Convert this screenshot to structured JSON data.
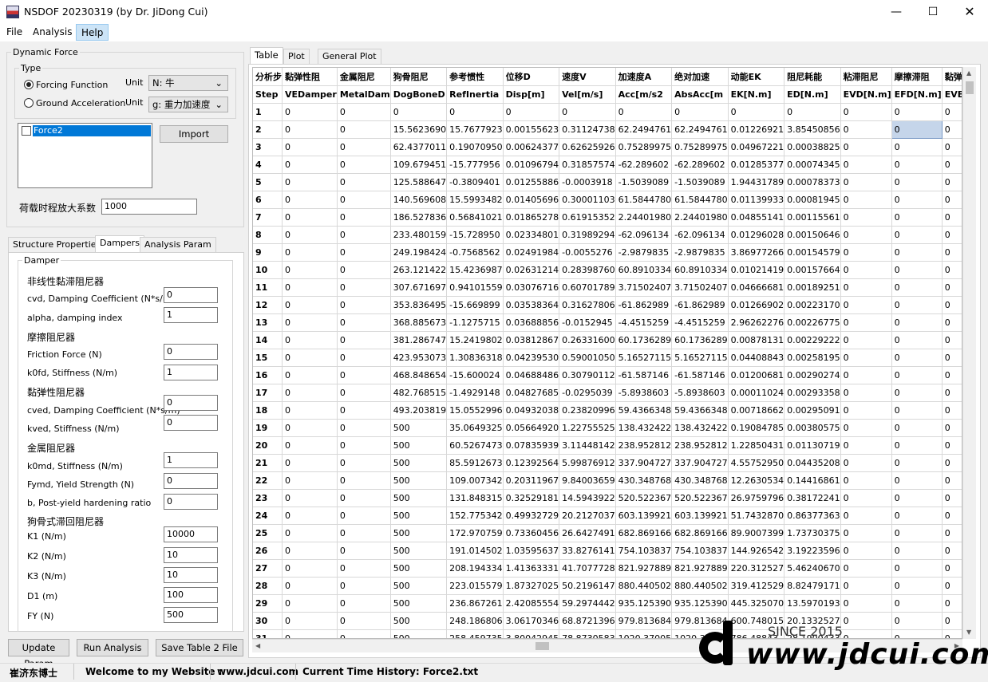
{
  "window": {
    "title": "NSDOF 20230319 (by Dr. JiDong Cui)"
  },
  "menu": [
    "File",
    "Analysis",
    "Help"
  ],
  "dynamic_force": {
    "group_label": "Dynamic Force",
    "type_label": "Type",
    "forcing_function": "Forcing Function",
    "ground_acceleration": "Ground Acceleration",
    "unit_label": "Unit",
    "unit_force": "N: 牛",
    "unit_accel": "g: 重力加速度",
    "list_items": [
      "Force2"
    ],
    "import_label": "Import",
    "scale_label": "荷载时程放大系数",
    "scale_value": "1000"
  },
  "left_tabs": [
    "Structure Properties",
    "Dampers",
    "Analysis Param"
  ],
  "damper": {
    "group_label": "Damper",
    "nonlinear_title": "非线性黏滞阻尼器",
    "cvd_label": "cvd, Damping Coefficient (N*s/m)",
    "cvd_value": "0",
    "alpha_label": "alpha, damping index",
    "alpha_value": "1",
    "friction_title": "摩擦阻尼器",
    "friction_label": "Friction Force (N)",
    "friction_value": "0",
    "k0fd_label": "k0fd, Stiffness (N/m)",
    "k0fd_value": "1",
    "viscoelastic_title": "黏弹性阻尼器",
    "cved_label": "cved, Damping Coefficient (N*s/m)",
    "cved_value": "0",
    "kved_label": "kved, Stiffness (N/m)",
    "kved_value": "0",
    "metal_title": "金属阻尼器",
    "k0md_label": "k0md, Stiffness (N/m)",
    "k0md_value": "1",
    "fymd_label": "Fymd, Yield Strength (N)",
    "fymd_value": "0",
    "b_label": "b, Post-yield hardening ratio",
    "b_value": "0",
    "dogbone_title": "狗骨式滞回阻尼器",
    "k1_label": "K1  (N/m)",
    "k1_value": "10000",
    "k2_label": "K2  (N/m)",
    "k2_value": "10",
    "k3_label": "K3  (N/m)",
    "k3_value": "10",
    "d1_label": "D1  (m)",
    "d1_value": "100",
    "fy_label": "FY  (N)",
    "fy_value": "500"
  },
  "buttons": {
    "update": "Update Param",
    "run": "Run Analysis",
    "save": "Save Table 2 File"
  },
  "right_tabs": [
    "Table",
    "Plot",
    "General Plot"
  ],
  "table": {
    "header_cn": [
      "分析步",
      "黏弹性阻",
      "金属阻尼",
      "狗骨阻尼",
      "参考惯性",
      "位移D",
      "速度V",
      "加速度A",
      "绝对加速",
      "动能EK",
      "阻尼耗能",
      "粘滞阻尼",
      "摩擦滞阻",
      "黏弹性阻"
    ],
    "header_en": [
      "Step",
      "VEDamper",
      "MetalDam",
      "DogBoneD",
      "RefInertia",
      "Disp[m]",
      "Vel[m/s]",
      "Acc[m/s2",
      "AbsAcc[m",
      "EK[N.m]",
      "ED[N.m]",
      "EVD[N.m]",
      "EFD[N.m]",
      "EVED[N.m"
    ],
    "rows": [
      [
        "1",
        "0",
        "0",
        "0",
        "0",
        "0",
        "0",
        "0",
        "0",
        "0",
        "0",
        "0",
        "0",
        "0"
      ],
      [
        "2",
        "0",
        "0",
        "15.5623690",
        "15.7677923",
        "0.00155623",
        "0.31124738",
        "62.2494761",
        "62.2494761",
        "0.01226921",
        "3.85450856",
        "0",
        "0",
        "0"
      ],
      [
        "3",
        "0",
        "0",
        "62.4377011",
        "0.19070950",
        "0.00624377",
        "0.62625926",
        "0.75289975",
        "0.75289975",
        "0.04967221",
        "0.00038825",
        "0",
        "0",
        "0"
      ],
      [
        "4",
        "0",
        "0",
        "109.679451",
        "-15.777956",
        "0.01096794",
        "0.31857574",
        "-62.289602",
        "-62.289602",
        "0.01285377",
        "0.00074345",
        "0",
        "0",
        "0"
      ],
      [
        "5",
        "0",
        "0",
        "125.588647",
        "-0.3809401",
        "0.01255886",
        "-0.0003918",
        "-1.5039089",
        "-1.5039089",
        "1.94431789",
        "0.00078373",
        "0",
        "0",
        "0"
      ],
      [
        "6",
        "0",
        "0",
        "140.569608",
        "15.5993482",
        "0.01405696",
        "0.30001103",
        "61.5844780",
        "61.5844780",
        "0.01139933",
        "0.00081945",
        "0",
        "0",
        "0"
      ],
      [
        "7",
        "0",
        "0",
        "186.527836",
        "0.56841021",
        "0.01865278",
        "0.61915352",
        "2.24401980",
        "2.24401980",
        "0.04855141",
        "0.00115561",
        "0",
        "0",
        "0"
      ],
      [
        "8",
        "0",
        "0",
        "233.480159",
        "-15.728950",
        "0.02334801",
        "0.31989294",
        "-62.096134",
        "-62.096134",
        "0.01296028",
        "0.00150646",
        "0",
        "0",
        "0"
      ],
      [
        "9",
        "0",
        "0",
        "249.198424",
        "-0.7568562",
        "0.02491984",
        "-0.0055276",
        "-2.9879835",
        "-2.9879835",
        "3.86977266",
        "0.00154579",
        "0",
        "0",
        "0"
      ],
      [
        "10",
        "0",
        "0",
        "263.121422",
        "15.4236987",
        "0.02631214",
        "0.28398760",
        "60.8910334",
        "60.8910334",
        "0.01021419",
        "0.00157664",
        "0",
        "0",
        "0"
      ],
      [
        "11",
        "0",
        "0",
        "307.671697",
        "0.94101559",
        "0.03076716",
        "0.60701789",
        "3.71502407",
        "3.71502407",
        "0.04666681",
        "0.00189251",
        "0",
        "0",
        "0"
      ],
      [
        "12",
        "0",
        "0",
        "353.836495",
        "-15.669899",
        "0.03538364",
        "0.31627806",
        "-61.862989",
        "-61.862989",
        "0.01266902",
        "0.00223170",
        "0",
        "0",
        "0"
      ],
      [
        "13",
        "0",
        "0",
        "368.885673",
        "-1.1275715",
        "0.03688856",
        "-0.0152945",
        "-4.4515259",
        "-4.4515259",
        "2.96262276",
        "0.00226775",
        "0",
        "0",
        "0"
      ],
      [
        "14",
        "0",
        "0",
        "381.286747",
        "15.2419802",
        "0.03812867",
        "0.26331600",
        "60.1736289",
        "60.1736289",
        "0.00878131",
        "0.00229222",
        "0",
        "0",
        "0"
      ],
      [
        "15",
        "0",
        "0",
        "423.953073",
        "1.30836318",
        "0.04239530",
        "0.59001050",
        "5.16527115",
        "5.16527115",
        "0.04408843",
        "0.00258195",
        "0",
        "0",
        "0"
      ],
      [
        "16",
        "0",
        "0",
        "468.848654",
        "-15.600024",
        "0.04688486",
        "0.30790112",
        "-61.587146",
        "-61.587146",
        "0.01200681",
        "0.00290274",
        "0",
        "0",
        "0"
      ],
      [
        "17",
        "0",
        "0",
        "482.768515",
        "-1.4929148",
        "0.04827685",
        "-0.0295039",
        "-5.8938603",
        "-5.8938603",
        "0.00011024",
        "0.00293358",
        "0",
        "0",
        "0"
      ],
      [
        "18",
        "0",
        "0",
        "493.203819",
        "15.0552996",
        "0.04932038",
        "0.23820996",
        "59.4366348",
        "59.4366348",
        "0.00718662",
        "0.00295091",
        "0",
        "0",
        "0"
      ],
      [
        "19",
        "0",
        "0",
        "500",
        "35.0649325",
        "0.05664920",
        "1.22755525",
        "138.432422",
        "138.432422",
        "0.19084785",
        "0.00380575",
        "0",
        "0",
        "0"
      ],
      [
        "20",
        "0",
        "0",
        "500",
        "60.5267473",
        "0.07835939",
        "3.11448142",
        "238.952812",
        "238.952812",
        "1.22850431",
        "0.01130719",
        "0",
        "0",
        "0"
      ],
      [
        "21",
        "0",
        "0",
        "500",
        "85.5912673",
        "0.12392564",
        "5.99876912",
        "337.904727",
        "337.904727",
        "4.55752950",
        "0.04435208",
        "0",
        "0",
        "0"
      ],
      [
        "22",
        "0",
        "0",
        "500",
        "109.007342",
        "0.20311967",
        "9.84003659",
        "430.348768",
        "430.348768",
        "12.2630534",
        "0.14416861",
        "0",
        "0",
        "0"
      ],
      [
        "23",
        "0",
        "0",
        "500",
        "131.848315",
        "0.32529181",
        "14.5943922",
        "520.522367",
        "520.522367",
        "26.9759796",
        "0.38172241",
        "0",
        "0",
        "0"
      ],
      [
        "24",
        "0",
        "0",
        "500",
        "152.775342",
        "0.49932729",
        "20.2127037",
        "603.139921",
        "603.139921",
        "51.7432870",
        "0.86377363",
        "0",
        "0",
        "0"
      ],
      [
        "25",
        "0",
        "0",
        "500",
        "172.970759",
        "0.73360456",
        "26.6427491",
        "682.869166",
        "682.869166",
        "89.9007399",
        "1.73730375",
        "0",
        "0",
        "0"
      ],
      [
        "26",
        "0",
        "0",
        "500",
        "191.014502",
        "1.03595637",
        "33.8276141",
        "754.103837",
        "754.103837",
        "144.926542",
        "3.19223596",
        "0",
        "0",
        "0"
      ],
      [
        "27",
        "0",
        "0",
        "500",
        "208.194334",
        "1.41363331",
        "41.7077728",
        "821.927889",
        "821.927889",
        "220.312527",
        "5.46240670",
        "0",
        "0",
        "0"
      ],
      [
        "28",
        "0",
        "0",
        "500",
        "223.015579",
        "1.87327025",
        "50.2196147",
        "880.440502",
        "880.440502",
        "319.412529",
        "8.82479171",
        "0",
        "0",
        "0"
      ],
      [
        "29",
        "0",
        "0",
        "500",
        "236.867261",
        "2.42085554",
        "59.2974442",
        "935.125390",
        "935.125390",
        "445.325070",
        "13.5970193",
        "0",
        "0",
        "0"
      ],
      [
        "30",
        "0",
        "0",
        "500",
        "248.186806",
        "3.06170346",
        "68.8721396",
        "979.813684",
        "979.813684",
        "600.748015",
        "20.1332527",
        "0",
        "0",
        "0"
      ],
      [
        "31",
        "0",
        "0",
        "500",
        "258.459735",
        "3.80042945",
        "78.8730583",
        "1020.37005",
        "1020.37005",
        "786.48843",
        "28.1900433",
        "0",
        "0",
        "0"
      ]
    ]
  },
  "status": {
    "name": "崔济东博士",
    "welcome": "Welcome to my Website :",
    "site": "www.jdcui.com",
    "current": "Current Time History: Force2.txt"
  },
  "watermark": {
    "since": "SINCE 2015",
    "url": "www.jdcui.com"
  }
}
